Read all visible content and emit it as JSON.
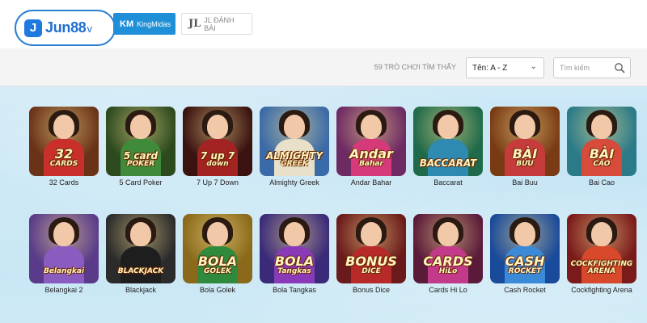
{
  "brand": {
    "logo_text": "Jun88",
    "logo_suffix": "v",
    "logo_badge": "J"
  },
  "providers": [
    {
      "icon": "KM",
      "label": "KingMidas",
      "active": true
    },
    {
      "icon": "JL",
      "label": "JL ĐÁNH BÀI",
      "active": false
    }
  ],
  "filter": {
    "count_text": "59 TRÒ CHƠI TÌM THẤY",
    "sort_selected": "Tên: A - Z",
    "search_placeholder": "Tìm kiếm"
  },
  "games": [
    {
      "label": "32 Cards",
      "art": "32",
      "art_sub": "CARDS",
      "bg": "#6a3318",
      "body": "#c9302c"
    },
    {
      "label": "5 Card Poker",
      "art": "5 card",
      "art_sub": "POKER",
      "bg": "#2d4a1e",
      "body": "#3f8b3a"
    },
    {
      "label": "7 Up 7 Down",
      "art": "7 up 7",
      "art_sub": "down",
      "bg": "#3a1210",
      "body": "#a32222"
    },
    {
      "label": "Almighty Greek",
      "art": "ALMIGHTY",
      "art_sub": "GREEK",
      "bg": "#3a6aa8",
      "body": "#e8e0c8"
    },
    {
      "label": "Andar Bahar",
      "art": "Andar",
      "art_sub": "Bahar",
      "bg": "#6d2a63",
      "body": "#d63a7a"
    },
    {
      "label": "Baccarat",
      "art": "BACCARAT",
      "art_sub": "",
      "bg": "#1f6a4a",
      "body": "#2e8ab0"
    },
    {
      "label": "Bai Buu",
      "art": "BÀI",
      "art_sub": "BỬU",
      "bg": "#7a3b14",
      "body": "#c63b3b"
    },
    {
      "label": "Bai Cao",
      "art": "BÀI",
      "art_sub": "CÀO",
      "bg": "#2a7a88",
      "body": "#d64b3b"
    },
    {
      "label": "Belangkai 2",
      "art": "Belangkai",
      "art_sub": "",
      "bg": "#5a3b8a",
      "body": "#8a5cc0"
    },
    {
      "label": "Blackjack",
      "art": "BLACKJACK",
      "art_sub": "",
      "bg": "#2b2b2b",
      "body": "#1e1e1e"
    },
    {
      "label": "Bola Golek",
      "art": "BOLA",
      "art_sub": "GOLEK",
      "bg": "#8a6a1a",
      "body": "#2f8a3e"
    },
    {
      "label": "Bola Tangkas",
      "art": "BOLA",
      "art_sub": "Tangkas",
      "bg": "#3a2a7a",
      "body": "#8a3ab8"
    },
    {
      "label": "Bonus Dice",
      "art": "BONUS",
      "art_sub": "DICE",
      "bg": "#6a1a1a",
      "body": "#b82a2a"
    },
    {
      "label": "Cards Hi Lo",
      "art": "CARDS",
      "art_sub": "HiLo",
      "bg": "#5a1a3a",
      "body": "#c33a8a"
    },
    {
      "label": "Cash Rocket",
      "art": "CASH",
      "art_sub": "ROCKET",
      "bg": "#1a4a9a",
      "body": "#3a8ad8"
    },
    {
      "label": "Cockfighting Arena",
      "art": "COCKFIGHTING",
      "art_sub": "ARENA",
      "bg": "#7a1a1a",
      "body": "#d8482a"
    }
  ]
}
